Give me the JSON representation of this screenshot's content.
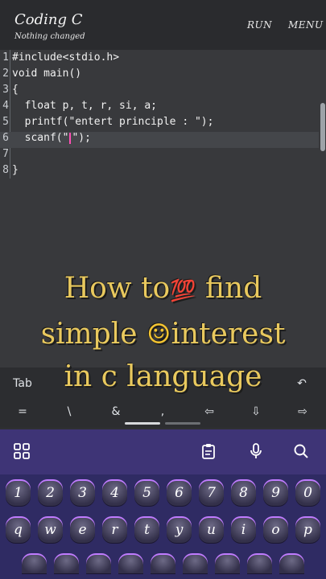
{
  "header": {
    "title": "Coding C",
    "subtitle": "Nothing changed",
    "run_label": "RUN",
    "menu_label": "MENU"
  },
  "code": {
    "lines": [
      {
        "num": "1",
        "text": "#include<stdio.h>"
      },
      {
        "num": "2",
        "text": "void main()"
      },
      {
        "num": "3",
        "text": "{"
      },
      {
        "num": "4",
        "text": "  float p, t, r, si, a;"
      },
      {
        "num": "5",
        "text": "  printf(\"entert principle : \");"
      },
      {
        "num": "6",
        "text_before": "  scanf(\"",
        "text_after": "\");"
      },
      {
        "num": "7",
        "text": ""
      },
      {
        "num": "8",
        "text": "}"
      }
    ]
  },
  "caption": {
    "line1_a": "How to",
    "line1_emoji": "💯",
    "line1_b": " find",
    "line2_a": "simple ",
    "line2_emoji": "☺",
    "line2_b": "interest",
    "line3": "in c language"
  },
  "extra_keys": {
    "row1": [
      "Tab",
      "↶"
    ],
    "row2": [
      "=",
      "\\",
      "&",
      ",",
      "⇦",
      "⇩",
      "⇨"
    ]
  },
  "toolbar": {
    "icons": [
      "apps-grid-icon",
      "clipboard-icon",
      "microphone-icon",
      "search-icon"
    ]
  },
  "keyboard": {
    "row1": [
      "1",
      "2",
      "3",
      "4",
      "5",
      "6",
      "7",
      "8",
      "9",
      "0"
    ],
    "row2": [
      "q",
      "w",
      "e",
      "r",
      "t",
      "y",
      "u",
      "i",
      "o",
      "p"
    ]
  },
  "colors": {
    "accent": "#e9c95e",
    "keyboard_bg": "#2f2b63",
    "toolbar_bg": "#3e3476",
    "cursor": "#ff4fb5"
  }
}
